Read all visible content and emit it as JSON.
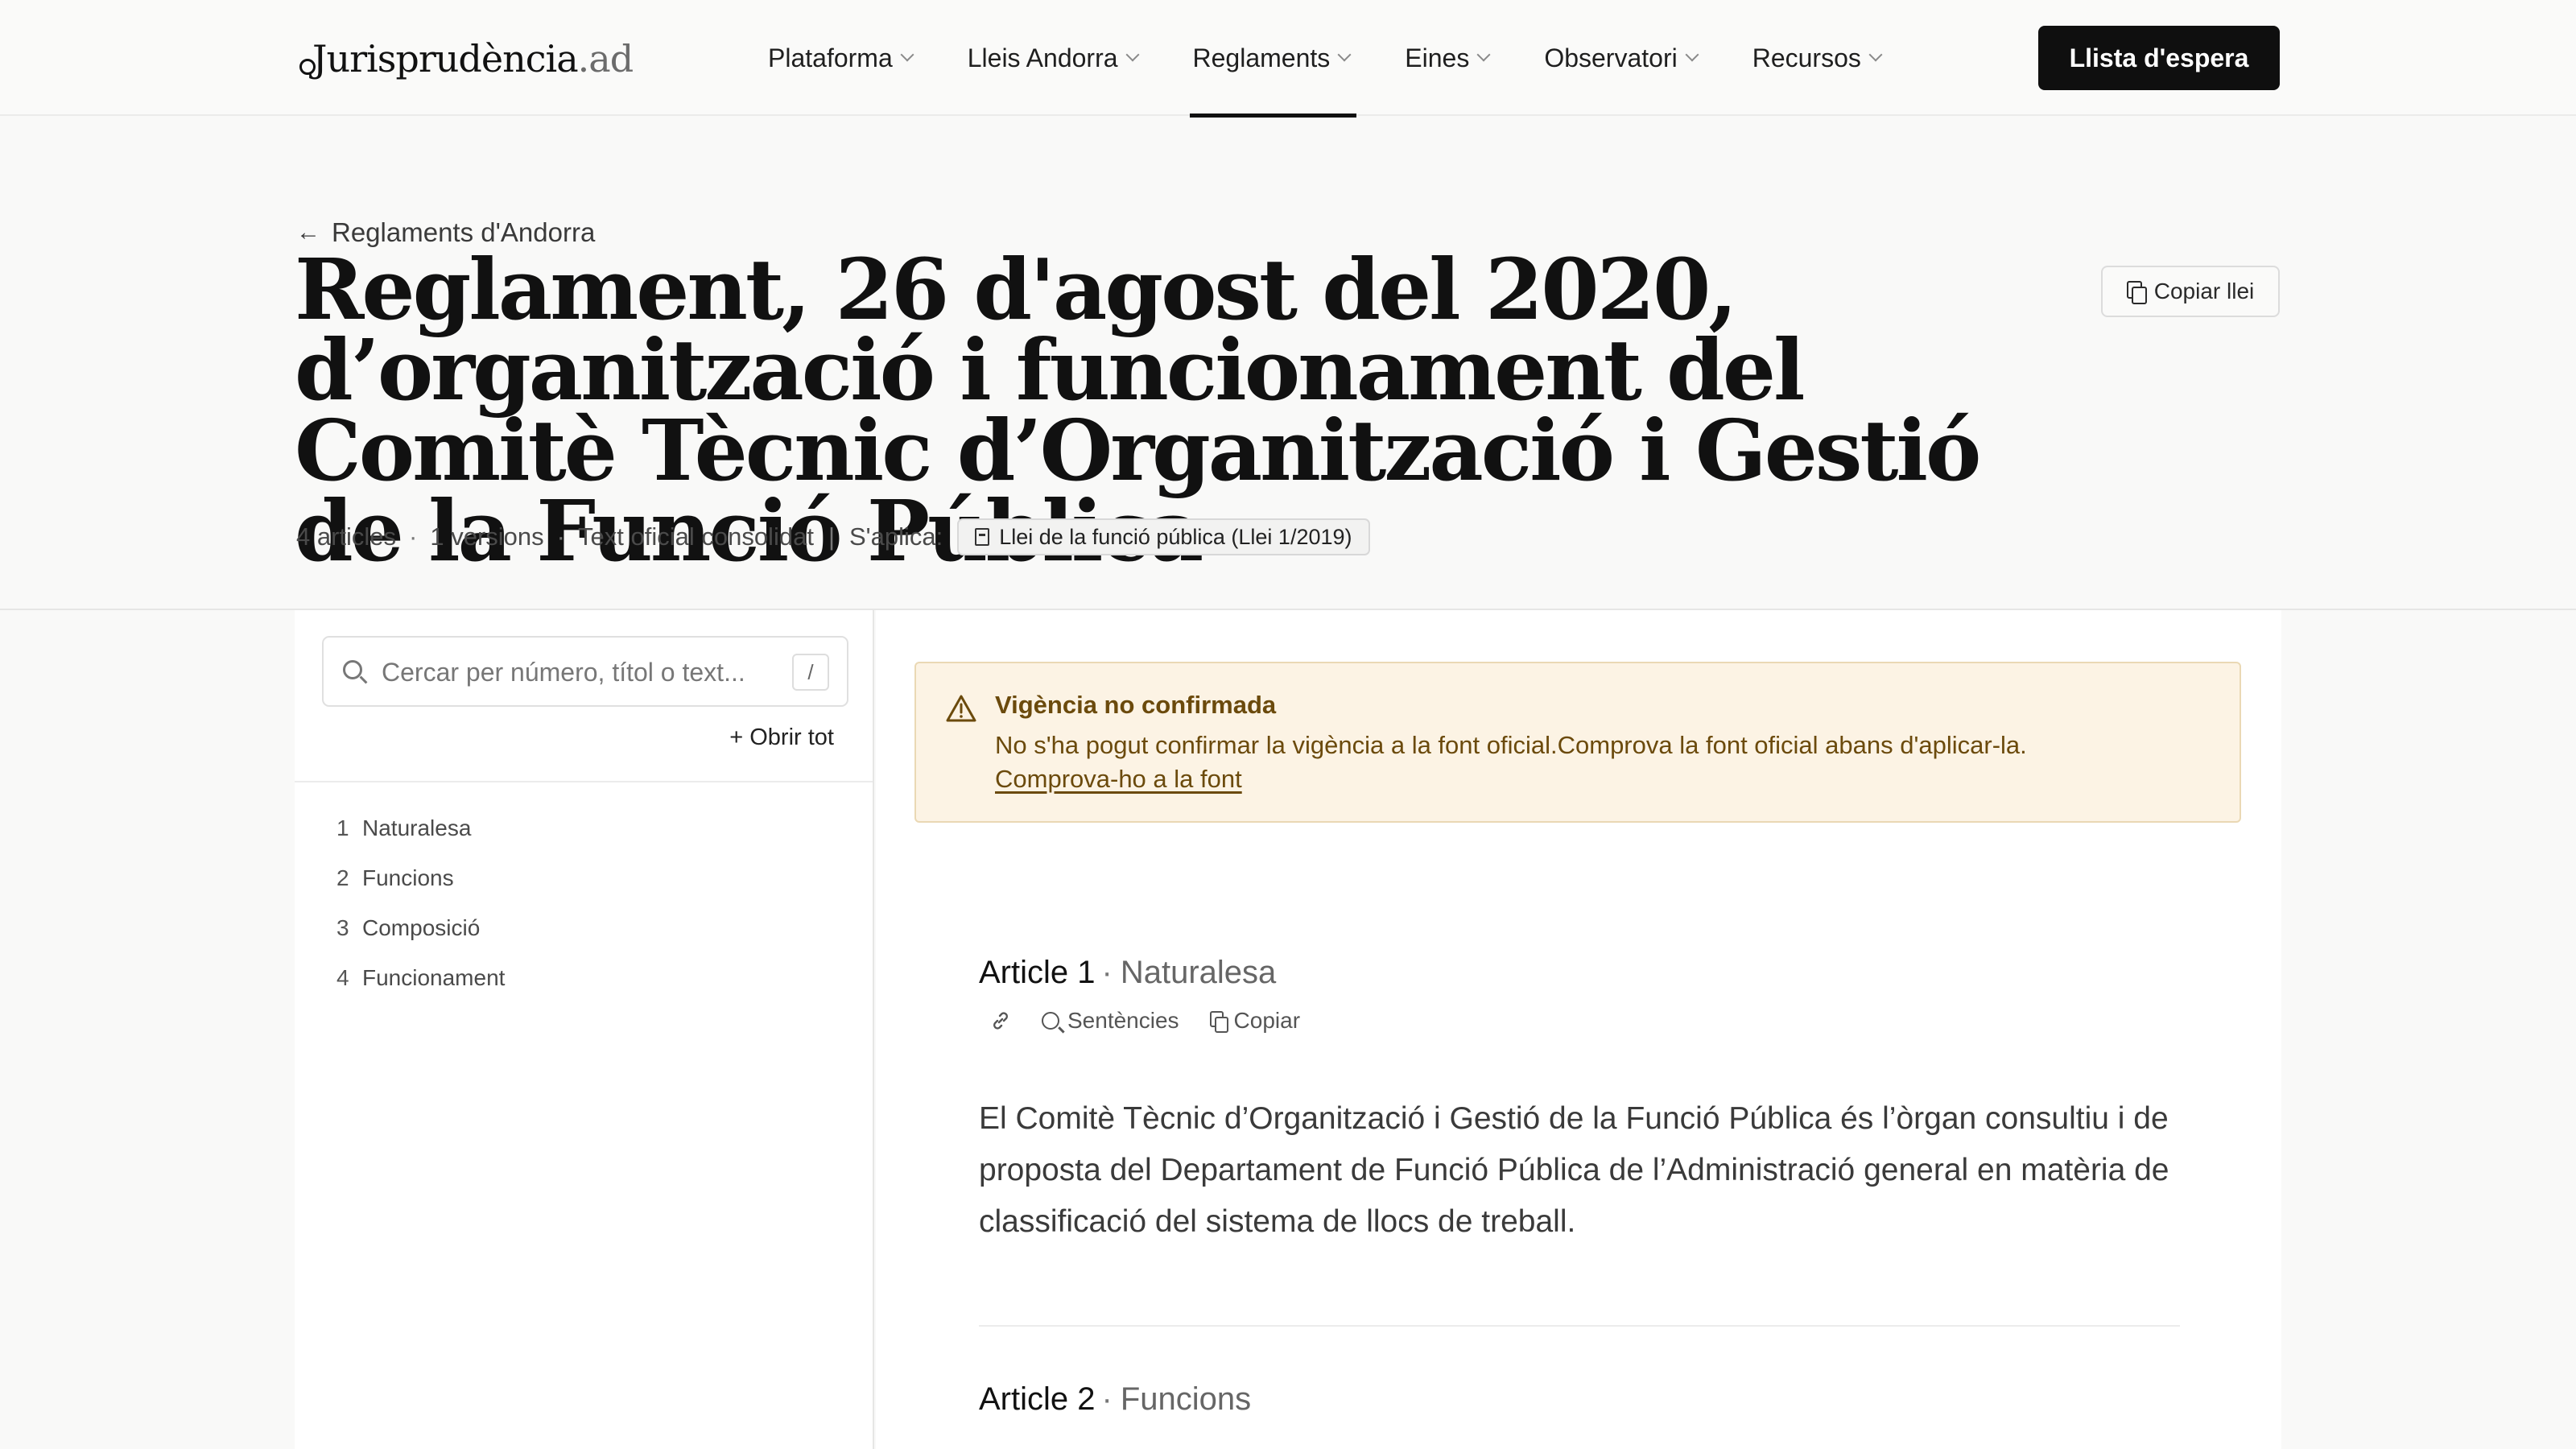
{
  "header": {
    "logo_main": "Jurisprudència",
    "logo_tld": ".ad",
    "nav": [
      {
        "label": "Plataforma"
      },
      {
        "label": "Lleis Andorra"
      },
      {
        "label": "Reglaments"
      },
      {
        "label": "Eines"
      },
      {
        "label": "Observatori"
      },
      {
        "label": "Recursos"
      }
    ],
    "active_nav": "Reglaments",
    "cta_label": "Llista d'espera"
  },
  "page": {
    "back_label": "Reglaments d'Andorra",
    "title": "Reglament, 26 d'agost del 2020, d’organització i funcionament del Comitè Tècnic d’Organització i Gestió de la Funció Pública",
    "copy_law_label": "Copiar llei",
    "meta": {
      "articles": "4 articles",
      "separator": "·",
      "versions": "1 versions",
      "text_type": "Text oficial consolidat",
      "pipe": "|",
      "applies_label": "S'aplica:",
      "applies_chip": "Llei de la funció pública (Llei 1/2019)"
    }
  },
  "sidebar": {
    "search_placeholder": "Cercar per número, títol o text...",
    "shortcut_key": "/",
    "open_all_label": "+ Obrir tot",
    "toc": [
      {
        "num": "1",
        "label": "Naturalesa"
      },
      {
        "num": "2",
        "label": "Funcions"
      },
      {
        "num": "3",
        "label": "Composició"
      },
      {
        "num": "4",
        "label": "Funcionament"
      }
    ]
  },
  "alert": {
    "title": "Vigència no confirmada",
    "text": "No s'ha pogut confirmar la vigència a la font oficial.Comprova la font oficial abans d'aplicar-la.",
    "link": "Comprova-ho a la font",
    "color": "#6b4a0c",
    "background": "#fcf3e4"
  },
  "articles": [
    {
      "label": "Article 1",
      "separator": "·",
      "name": "Naturalesa",
      "actions": {
        "sentences": "Sentències",
        "copy": "Copiar"
      },
      "body": "El Comitè Tècnic d’Organització i Gestió de la Funció Pública és l’òrgan consultiu i de proposta del Departament de Funció Pública de l’Administració general en matèria de classificació del sistema de llocs de treball."
    },
    {
      "label": "Article 2",
      "separator": "·",
      "name": "Funcions"
    }
  ]
}
